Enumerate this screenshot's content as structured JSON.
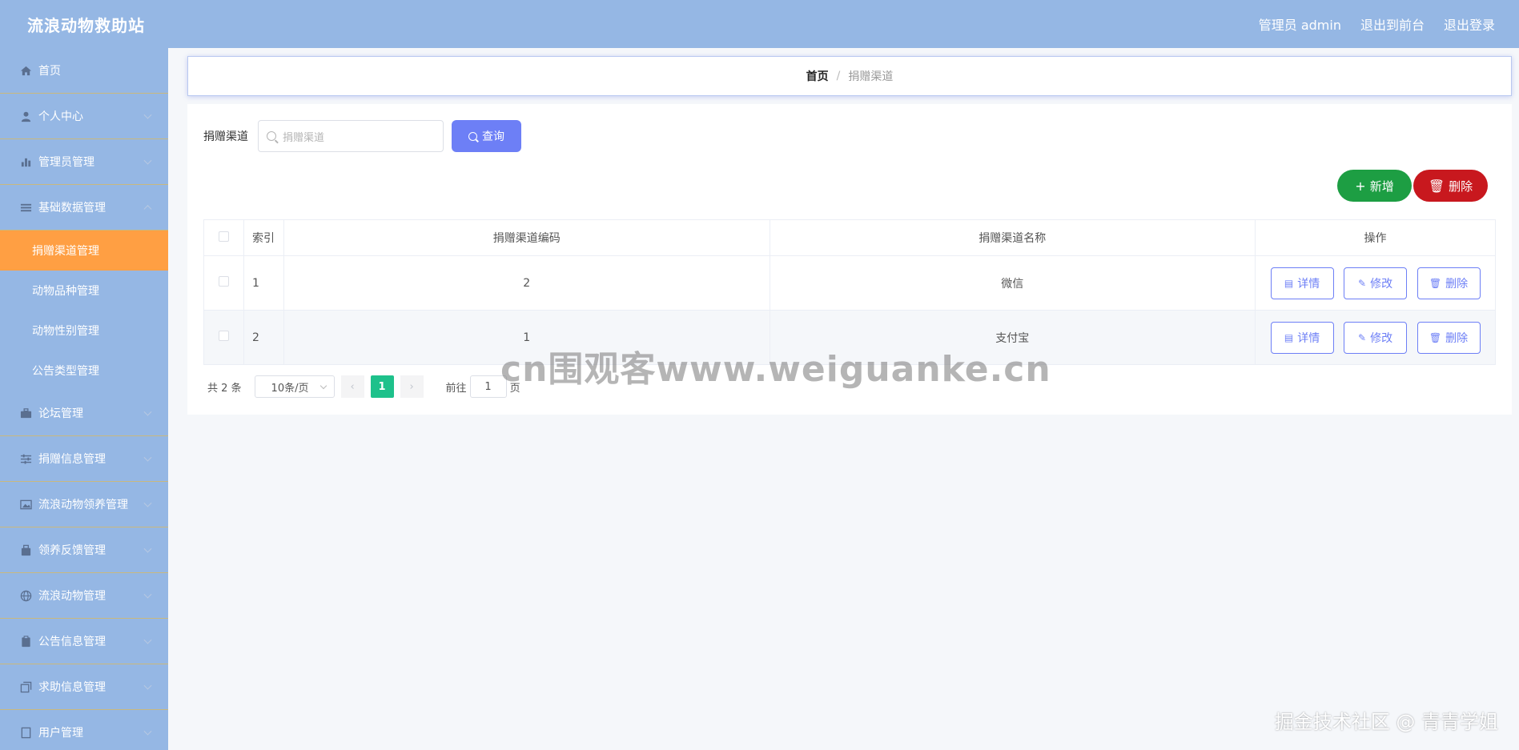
{
  "app": {
    "title": "流浪动物救助站"
  },
  "header": {
    "user": "管理员 admin",
    "front_link": "退出到前台",
    "logout": "退出登录"
  },
  "sidebar": {
    "items": [
      {
        "label": "首页",
        "icon": "home-icon"
      },
      {
        "label": "个人中心",
        "icon": "user-icon"
      },
      {
        "label": "管理员管理",
        "icon": "chart-icon"
      },
      {
        "label": "基础数据管理",
        "icon": "list-icon"
      }
    ],
    "sub_items": [
      "捐赠渠道管理",
      "动物品种管理",
      "动物性别管理",
      "公告类型管理"
    ],
    "more_items": [
      {
        "label": "论坛管理",
        "icon": "briefcase-icon"
      },
      {
        "label": "捐赠信息管理",
        "icon": "sliders-icon"
      },
      {
        "label": "流浪动物领养管理",
        "icon": "picture-icon"
      },
      {
        "label": "领养反馈管理",
        "icon": "bag-icon"
      },
      {
        "label": "流浪动物管理",
        "icon": "globe-icon"
      },
      {
        "label": "公告信息管理",
        "icon": "clipboard-icon"
      },
      {
        "label": "求助信息管理",
        "icon": "copy-icon"
      },
      {
        "label": "用户管理",
        "icon": "document-icon"
      }
    ]
  },
  "breadcrumb": {
    "home": "首页",
    "separator": "/",
    "current": "捐赠渠道"
  },
  "search": {
    "label": "捐赠渠道",
    "placeholder": "捐赠渠道",
    "button": "查询"
  },
  "actions": {
    "add": "新增",
    "delete": "删除"
  },
  "table": {
    "headers": [
      "索引",
      "捐赠渠道编码",
      "捐赠渠道名称",
      "操作"
    ],
    "rows": [
      {
        "index": "1",
        "code": "2",
        "name": "微信"
      },
      {
        "index": "2",
        "code": "1",
        "name": "支付宝"
      }
    ],
    "row_actions": {
      "detail": "详情",
      "edit": "修改",
      "delete": "删除"
    }
  },
  "pagination": {
    "total": "共 2 条",
    "page_size": "10条/页",
    "current_page": "1",
    "goto_prefix": "前往",
    "goto_value": "1",
    "goto_suffix": "页"
  },
  "overlay": {
    "watermark": "cn围观客www.weiguanke.cn",
    "credit": "掘金技术社区 @ 青青学姐"
  },
  "colors": {
    "header_bg": "#95b7e4",
    "active_menu": "#ff9f43",
    "primary": "#6d7ff6",
    "add": "#1d9e43",
    "delete": "#c8181e",
    "page_active": "#1ec18b"
  }
}
